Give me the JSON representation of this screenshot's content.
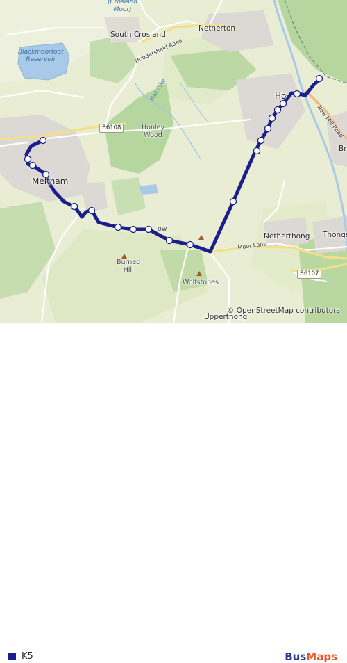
{
  "map": {
    "places": [
      {
        "id": "crosland-moor",
        "text": "(Crosland\nMoor)",
        "kind": "water"
      },
      {
        "id": "south-crosland",
        "text": "South Crosland",
        "kind": "village"
      },
      {
        "id": "netherton",
        "text": "Netherton",
        "kind": "village"
      },
      {
        "id": "blackmoorfoot-reservoir",
        "text": "Blackmoorfoot\nReservoir",
        "kind": "water"
      },
      {
        "id": "honley-wood",
        "text": "Honley\nWood",
        "kind": "feature"
      },
      {
        "id": "meltham",
        "text": "Meltham",
        "kind": "town"
      },
      {
        "id": "honley",
        "text": "Ho",
        "kind": "town"
      },
      {
        "id": "netherthong",
        "text": "Netherthong",
        "kind": "village"
      },
      {
        "id": "thongsbridge",
        "text": "Thongs",
        "kind": "village"
      },
      {
        "id": "burned-hill",
        "text": "Burned\nHill",
        "kind": "feature"
      },
      {
        "id": "wolfstones",
        "text": "Wolfstones",
        "kind": "hamlet"
      },
      {
        "id": "upperthong",
        "text": "Upperthong",
        "kind": "village"
      },
      {
        "id": "brockholes",
        "text": "Br",
        "kind": "village"
      },
      {
        "id": "helme-fragment",
        "text": "ow",
        "kind": "hamlet"
      }
    ],
    "roads": [
      {
        "id": "b6108",
        "text": "B6108",
        "kind": "shield"
      },
      {
        "id": "b6107",
        "text": "B6107",
        "kind": "shield"
      },
      {
        "id": "huddersfield-road",
        "text": "Huddersfield Road",
        "kind": "road"
      },
      {
        "id": "moor-lane",
        "text": "Moor Lane",
        "kind": "road"
      },
      {
        "id": "new-mill-road",
        "text": "New Mill Road",
        "kind": "road"
      },
      {
        "id": "hall-dike",
        "text": "Hall Dike",
        "kind": "stream"
      }
    ],
    "attribution": "© OpenStreetMap contributors",
    "route_color": "#1a1f8c",
    "colors": {
      "land": "#e6ecd0",
      "woodland": "#b7d7a0",
      "urban": "#d9d6d0",
      "water": "#a9c9e8",
      "road_yellow": "#f6e79a"
    }
  },
  "legend": {
    "route_name": "K5",
    "swatch_color": "#1a1f8c"
  },
  "brand": {
    "part1": "Bus",
    "part2": "Maps"
  }
}
